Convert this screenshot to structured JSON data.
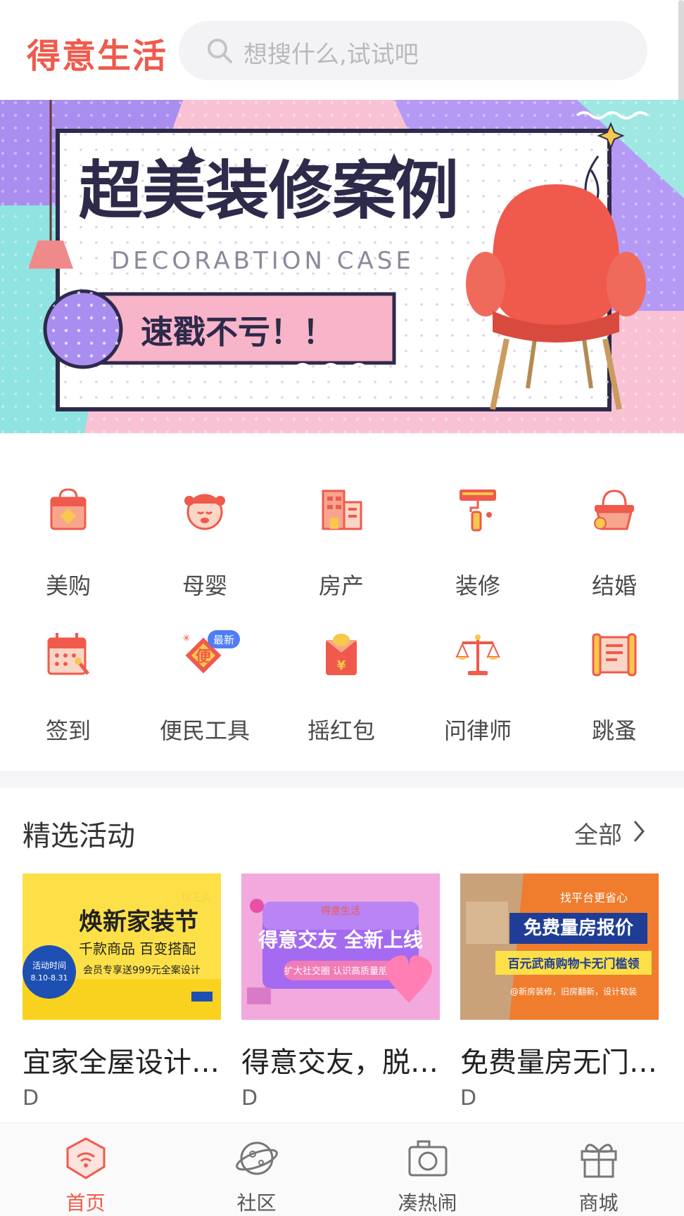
{
  "header": {
    "logo": "得意生活",
    "search_placeholder": "想搜什么,试试吧"
  },
  "banner": {
    "title": "超美装修案例",
    "subtitle": "DECORABTION CASE",
    "cta": "速戳不亏！！"
  },
  "categories": [
    {
      "label": "美购",
      "icon": "shopping-bag-icon"
    },
    {
      "label": "母婴",
      "icon": "baby-icon"
    },
    {
      "label": "房产",
      "icon": "building-icon"
    },
    {
      "label": "装修",
      "icon": "paint-roller-icon"
    },
    {
      "label": "结婚",
      "icon": "basket-icon"
    },
    {
      "label": "签到",
      "icon": "calendar-icon"
    },
    {
      "label": "便民工具",
      "icon": "convenience-icon",
      "badge": "最新",
      "glyph": "便"
    },
    {
      "label": "摇红包",
      "icon": "red-envelope-icon",
      "glyph": "¥"
    },
    {
      "label": "问律师",
      "icon": "scales-icon"
    },
    {
      "label": "跳蚤",
      "icon": "scroll-icon"
    }
  ],
  "section": {
    "title": "精选活动",
    "more": "全部"
  },
  "activities": [
    {
      "title": "宜家全屋设计…",
      "sub": "D",
      "thumb": {
        "headline": "焕新家装节",
        "line2": "千款商品  百变搭配",
        "line3": "会员专享送999元全案设计",
        "badge": "活动时间 8.10-8.31",
        "brand": "IKEA"
      }
    },
    {
      "title": "得意交友，脱…",
      "sub": "D",
      "thumb": {
        "brand": "得意生活",
        "headline": "得意交友 全新上线",
        "line2": "扩大社交圈 认识高质量朋友"
      }
    },
    {
      "title": "免费量房无门…",
      "sub": "D",
      "thumb": {
        "tag": "找平台更省心",
        "headline": "免费量房报价",
        "line2": "百元武商购物卡无门槛领",
        "line3": "@新房装修，旧房翻新，设计软装"
      }
    }
  ],
  "tabbar": [
    {
      "label": "首页",
      "icon": "home-icon",
      "active": true
    },
    {
      "label": "社区",
      "icon": "planet-icon",
      "active": false
    },
    {
      "label": "凑热闹",
      "icon": "camera-icon",
      "active": false
    },
    {
      "label": "商城",
      "icon": "gift-icon",
      "active": false
    }
  ],
  "colors": {
    "brand": "#ef5a4c",
    "tab_active": "#ef5a4c",
    "search_bg": "#f3f3f5"
  }
}
